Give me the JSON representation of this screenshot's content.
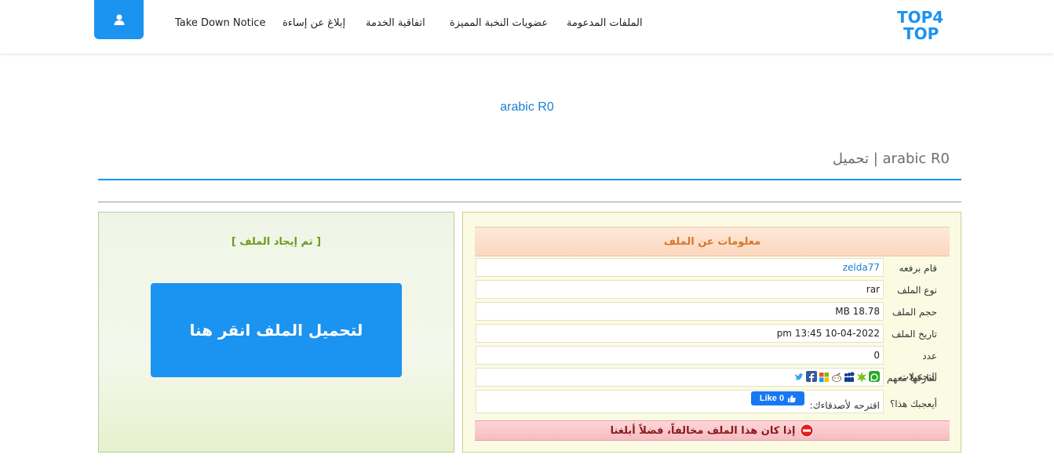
{
  "header": {
    "logo_top": "TOP4",
    "logo_bottom": "TOP",
    "nav": [
      "الملفات المدعومة",
      "عضويات النخبة المميزة",
      "اتفاقية الخدمة",
      "إبلاغ عن إساءة",
      "Take Down Notice"
    ]
  },
  "page": {
    "title_link": "arabic R0",
    "heading": "arabic R0 | تحميل"
  },
  "download": {
    "found_text": "[ تم إيجاد الملف ]",
    "button_label": "لتحميل الملف انقر هنا"
  },
  "info": {
    "header": "معلومات عن الملف",
    "rows": [
      {
        "label": "قام برفعه",
        "value": "zelda77"
      },
      {
        "label": "نوع الملف",
        "value": "rar"
      },
      {
        "label": "حجم الملف",
        "value": "MB 18.78"
      },
      {
        "label": "تاريخ الملف",
        "value": "10-04-2022 13:45 pm"
      },
      {
        "label": "عدد التحميلات",
        "value": "0"
      }
    ],
    "share_label": "شاركها معهم",
    "like_label": "أيعجبك هذا؟",
    "suggest_text": "اقترحه لأصدقاءك:",
    "fb_like": "Like 0",
    "report_text": "إذا كان هذا الملف مخالفاً، فضلاً أبلغنا"
  },
  "colors": {
    "accent": "#1b93f0",
    "found_green": "#6b9a1e",
    "info_orange": "#d9762a",
    "report_red": "#8a1a1a"
  },
  "share_icons": [
    "twitter-icon",
    "facebook-icon",
    "windows-live-icon",
    "reddit-icon",
    "myspace-icon",
    "digg-icon",
    "whatsapp-icon"
  ]
}
